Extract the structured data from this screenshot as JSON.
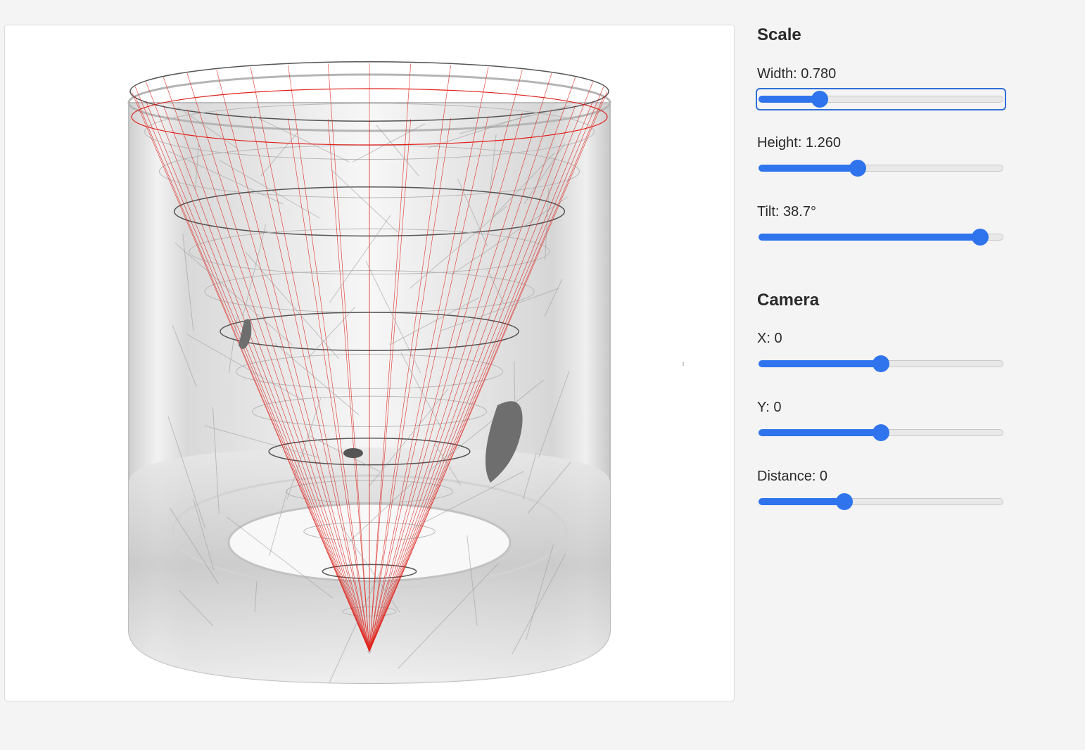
{
  "scale_section": {
    "title": "Scale",
    "width": {
      "label": "Width: 0.780",
      "fraction": 0.25
    },
    "height": {
      "label": "Height: 1.260",
      "fraction": 0.405
    },
    "tilt": {
      "label": "Tilt: 38.7°",
      "fraction": 0.905
    }
  },
  "camera_section": {
    "title": "Camera",
    "x": {
      "label": "X: 0",
      "fraction": 0.5
    },
    "y": {
      "label": "Y: 0",
      "fraction": 0.5
    },
    "distance": {
      "label": "Distance: 0",
      "fraction": 0.35
    }
  },
  "colors": {
    "accent": "#2f74ec",
    "wireframe": "#e0201a"
  }
}
